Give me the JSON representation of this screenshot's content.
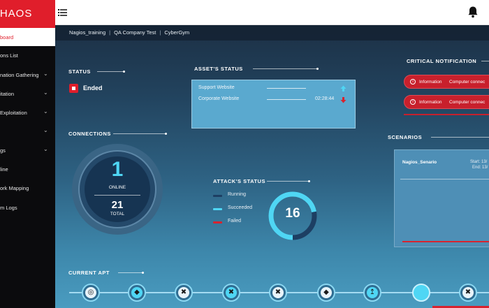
{
  "app": {
    "logo_text": "CHAOS"
  },
  "colors": {
    "accent": "#e01e2b",
    "online": "#4fd6f4",
    "running": "#1d3f63",
    "succeeded": "#4fd6f4",
    "failed": "#d7232f"
  },
  "sidebar": {
    "items": [
      {
        "label": "Dashboard",
        "active": true,
        "chevron": false
      },
      {
        "label": "Missions List",
        "active": false,
        "chevron": false
      },
      {
        "label": "Information Gathering",
        "active": false,
        "chevron": true
      },
      {
        "label": "Exploitation",
        "active": false,
        "chevron": true
      },
      {
        "label": "Post Exploitation",
        "active": false,
        "chevron": true
      },
      {
        "label": "",
        "active": false,
        "chevron": true
      },
      {
        "label": "Logs",
        "active": false,
        "chevron": true
      },
      {
        "label": "Online",
        "active": false,
        "chevron": false
      },
      {
        "label": "Network Mapping",
        "active": false,
        "chevron": false
      },
      {
        "label": "System Logs",
        "active": false,
        "chevron": false
      }
    ]
  },
  "sidebar_visible": [
    "board",
    "ons List",
    "nation Gathering",
    "itation",
    "Exploitation",
    "",
    "gs",
    "line",
    "ork Mapping",
    "m Logs"
  ],
  "topbar": {
    "menu_icon": "hamburger-menu-icon",
    "bell_icon": "bell-icon"
  },
  "breadcrumb": [
    "Nagios_training",
    "QA Company Test",
    "CyberGym"
  ],
  "status": {
    "title": "STATUS",
    "value": "Ended"
  },
  "assets": {
    "title": "ASSET'S STATUS",
    "items": [
      {
        "name": "Support Website",
        "time": "",
        "direction": "up"
      },
      {
        "name": "Corporate Website",
        "time": "02:28:44",
        "direction": "down"
      }
    ]
  },
  "connections": {
    "title": "CONNECTIONS",
    "online": "1",
    "online_label": "ONLINE",
    "total": "21",
    "total_label": "TOTAL"
  },
  "attack": {
    "title": "ATTACK'S STATUS",
    "legend": [
      {
        "label": "Running",
        "color": "#1d3f63"
      },
      {
        "label": "Succeeded",
        "color": "#4fd6f4"
      },
      {
        "label": "Failed",
        "color": "#d7232f"
      }
    ],
    "total": "16",
    "fractions": {
      "succeeded": 0.72,
      "running": 0.28,
      "failed": 0.0
    }
  },
  "notifications": {
    "title": "CRITICAL NOTIFICATION",
    "items": [
      {
        "type": "Information",
        "text": "Computer connec"
      },
      {
        "type": "Information",
        "text": "Computer connec"
      }
    ]
  },
  "scenarios": {
    "title": "SCENARIOS",
    "items": [
      {
        "name": "Nagios_Senario",
        "start": "Start: 13/",
        "end": "End: 13/"
      }
    ]
  },
  "apt": {
    "title": "CURRENT APT",
    "nodes": [
      {
        "icon": "target-icon",
        "glyph": "◎",
        "state": "todo"
      },
      {
        "icon": "cat-mask-icon",
        "glyph": "◆",
        "state": "done"
      },
      {
        "icon": "tools-icon",
        "glyph": "✖",
        "state": "todo"
      },
      {
        "icon": "tools-icon",
        "glyph": "✖",
        "state": "done"
      },
      {
        "icon": "tools-icon",
        "glyph": "✖",
        "state": "todo"
      },
      {
        "icon": "cat-mask-icon",
        "glyph": "◆",
        "state": "todo"
      },
      {
        "icon": "upload-icon",
        "glyph": "↥",
        "state": "done"
      },
      {
        "icon": "progress-icon",
        "glyph": "",
        "state": "current"
      },
      {
        "icon": "tools-icon",
        "glyph": "✖",
        "state": "todo"
      }
    ]
  }
}
